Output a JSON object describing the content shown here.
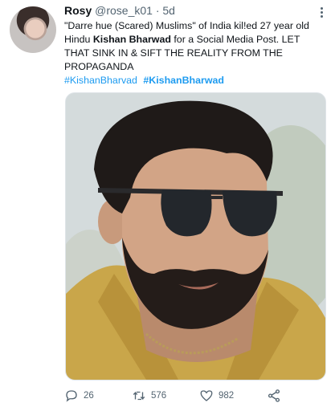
{
  "user": {
    "name": "Rosy",
    "handle": "@rose_k01",
    "time": "· 5d"
  },
  "tweet": {
    "line1": "\"Darre hue (Scared) Muslims\" of India kil!ed 27 year old",
    "line2_before": "Hindu ",
    "line2_bold": "Kishan Bharwad",
    "line2_after": " for a Social Media Post. LET",
    "line3": "THAT SINK IN & SIFT THE REALITY FROM THE",
    "line4": "PROPAGANDA",
    "hashtag1": "#KishanBharvad",
    "hashtag2": "#KishanBharwad"
  },
  "actions": {
    "replies": "26",
    "retweets": "576",
    "likes": "982"
  },
  "icons": [
    "more-icon",
    "reply-icon",
    "retweet-icon",
    "like-icon",
    "share-icon"
  ],
  "colors": {
    "link": "#1d9bf0",
    "muted": "#536471",
    "text": "#0f1419"
  }
}
